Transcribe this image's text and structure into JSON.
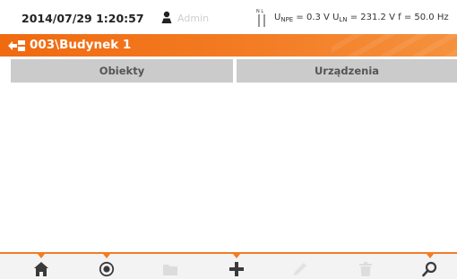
{
  "status_bar": {
    "datetime": "2014/07/29 1:20:57",
    "user": "Admin",
    "nl_label": "N L",
    "u_npe_label": "U",
    "u_npe_sub": "NPE",
    "u_npe_value": "= 0.3 V",
    "u_ln_label": "U",
    "u_ln_sub": "LN",
    "u_ln_value": "= 231.2 V",
    "freq": "f = 50.0 Hz"
  },
  "path_bar": {
    "path": "003\\Budynek 1",
    "accent": "#f37c24"
  },
  "tabs": [
    {
      "label": "Obiekty"
    },
    {
      "label": "Urządzenia"
    }
  ],
  "toolbar": {
    "buttons": [
      {
        "icon": "home-icon",
        "enabled": true
      },
      {
        "icon": "target-icon",
        "enabled": true
      },
      {
        "icon": "folder-icon",
        "enabled": false
      },
      {
        "icon": "plus-icon",
        "enabled": true
      },
      {
        "icon": "edit-icon",
        "enabled": false
      },
      {
        "icon": "trash-icon",
        "enabled": false
      },
      {
        "icon": "search-icon",
        "enabled": true
      }
    ]
  }
}
